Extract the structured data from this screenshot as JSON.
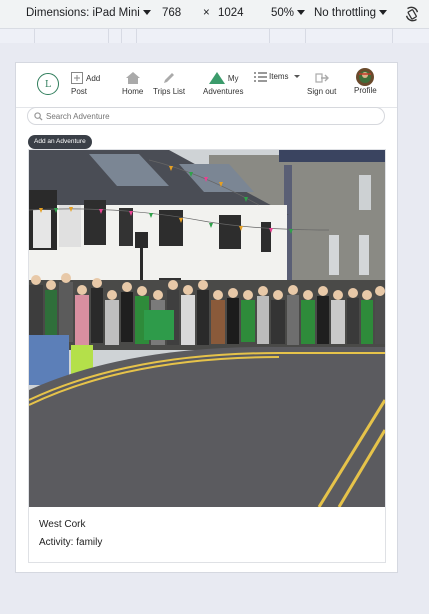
{
  "devtools": {
    "dimensions_label": "Dimensions: iPad Mini",
    "width": "768",
    "times": "×",
    "height": "1024",
    "zoom": "50%",
    "throttling": "No throttling",
    "rotate_icon": "rotate-icon"
  },
  "nav": {
    "logo_text": "L",
    "items": [
      {
        "label_top": "Add",
        "label": "Post",
        "icon": "plus-square-icon"
      },
      {
        "label": "Home",
        "icon": "home-icon"
      },
      {
        "label": "Trips List",
        "icon": "pencil-icon"
      },
      {
        "label_top": "My",
        "label": "Adventures",
        "icon": "mountain-icon"
      },
      {
        "label_top": "Items",
        "icon": "list-icon"
      },
      {
        "label": "Sign out",
        "icon": "sign-out-icon"
      },
      {
        "label": "Profile",
        "icon": "avatar"
      }
    ]
  },
  "search": {
    "placeholder": "Search Adventure"
  },
  "add_adventure_label": "Add an Adventure",
  "card": {
    "title": "West Cork",
    "activity": "Activity: family"
  },
  "colors": {
    "brand_green": "#2f7d5b",
    "button_dark": "#3a3f47"
  }
}
